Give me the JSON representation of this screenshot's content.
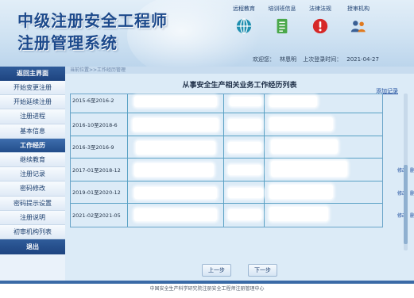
{
  "header": {
    "title_line1": "中级注册安全工程师",
    "title_line2": "注册管理系统",
    "nav": [
      {
        "label": "远程教育",
        "icon": "globe-icon"
      },
      {
        "label": "培训班信息",
        "icon": "document-icon"
      },
      {
        "label": "法律法规",
        "icon": "alert-icon"
      },
      {
        "label": "授审机构",
        "icon": "people-icon"
      }
    ],
    "welcome_label": "欢迎您：",
    "username": "林恩明",
    "last_login_label": "上次登录时间：",
    "last_login_time": "2021-04-27"
  },
  "sidebar": {
    "home": "返回主界面",
    "items": [
      {
        "label": "开始变更注册",
        "active": false
      },
      {
        "label": "开始延续注册",
        "active": false
      },
      {
        "label": "注册进程",
        "active": false
      },
      {
        "label": "基本信息",
        "active": false
      },
      {
        "label": "工作经历",
        "active": true
      },
      {
        "label": "继续教育",
        "active": false
      },
      {
        "label": "注册记录",
        "active": false
      },
      {
        "label": "密码修改",
        "active": false
      },
      {
        "label": "密码提示设置",
        "active": false
      },
      {
        "label": "注册说明",
        "active": false
      },
      {
        "label": "初审机构列表",
        "active": false
      }
    ],
    "exit": "退出"
  },
  "main": {
    "breadcrumb": "当前位置>>工作经历管理",
    "title": "从事安全生产相关业务工作经历列表",
    "add_link": "添加记录",
    "rows": [
      {
        "date": "2015-6至2016-2",
        "edit": "",
        "delete": ""
      },
      {
        "date": "2016-10至2018-6",
        "edit": "",
        "delete": ""
      },
      {
        "date": "2016-3至2016-9",
        "edit": "",
        "delete": ""
      },
      {
        "date": "2017-01至2018-12",
        "edit": "修改",
        "delete": "删除"
      },
      {
        "date": "2019-01至2020-12",
        "edit": "修改",
        "delete": "删除"
      },
      {
        "date": "2021-02至2021-05",
        "edit": "修改",
        "delete": "删除"
      }
    ],
    "prev_page": "上一步",
    "next_page": "下一步"
  },
  "footer": {
    "text": "中国安全生产科学研究院注册安全工程师注册管理中心"
  },
  "colors": {
    "brand_blue": "#1d4a8c",
    "active_nav": "#234d8a",
    "table_border": "#58a0c4",
    "link": "#1a4a9c"
  }
}
